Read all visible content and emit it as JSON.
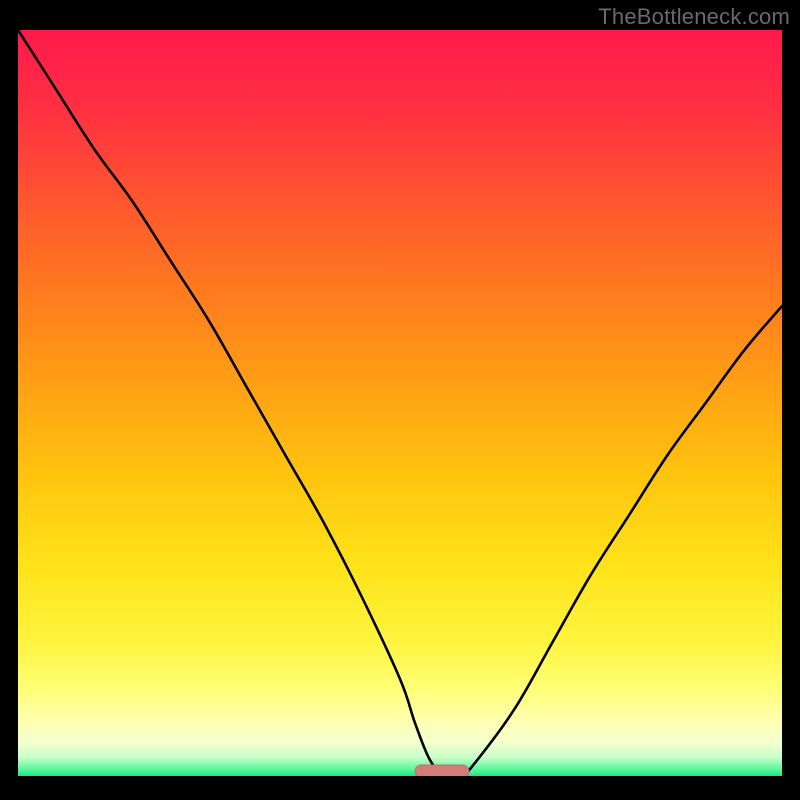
{
  "watermark": "TheBottleneck.com",
  "colors": {
    "frame": "#000000",
    "curve": "#000000",
    "marker_fill": "#d57b79",
    "marker_stroke": "#c96b69",
    "gradient_stops": [
      {
        "offset": 0.0,
        "color": "#ff1a4b"
      },
      {
        "offset": 0.1,
        "color": "#ff2e43"
      },
      {
        "offset": 0.22,
        "color": "#ff5330"
      },
      {
        "offset": 0.35,
        "color": "#ff7a1f"
      },
      {
        "offset": 0.48,
        "color": "#ffa114"
      },
      {
        "offset": 0.6,
        "color": "#ffc50e"
      },
      {
        "offset": 0.72,
        "color": "#ffe31a"
      },
      {
        "offset": 0.82,
        "color": "#fff43e"
      },
      {
        "offset": 0.885,
        "color": "#ffff79"
      },
      {
        "offset": 0.925,
        "color": "#ffffaf"
      },
      {
        "offset": 0.955,
        "color": "#f4ffce"
      },
      {
        "offset": 0.975,
        "color": "#c8ffca"
      },
      {
        "offset": 0.99,
        "color": "#63f79e"
      },
      {
        "offset": 1.0,
        "color": "#17e884"
      }
    ]
  },
  "chart_data": {
    "type": "line",
    "title": "",
    "xlabel": "",
    "ylabel": "",
    "xlim": [
      0,
      100
    ],
    "ylim": [
      0,
      100
    ],
    "grid": false,
    "legend": false,
    "series": [
      {
        "name": "bottleneck-curve",
        "x": [
          0,
          5,
          10,
          15,
          20,
          25,
          30,
          35,
          40,
          45,
          50,
          52,
          54,
          56,
          58,
          60,
          65,
          70,
          75,
          80,
          85,
          90,
          95,
          100
        ],
        "values": [
          100,
          92,
          84,
          77,
          69,
          61,
          52,
          43,
          34,
          24,
          13,
          7,
          2,
          0,
          0,
          2,
          9,
          18,
          27,
          35,
          43,
          50,
          57,
          63
        ]
      }
    ],
    "marker": {
      "name": "optimal-range",
      "x_center": 55.5,
      "width": 7,
      "y": 0
    }
  }
}
